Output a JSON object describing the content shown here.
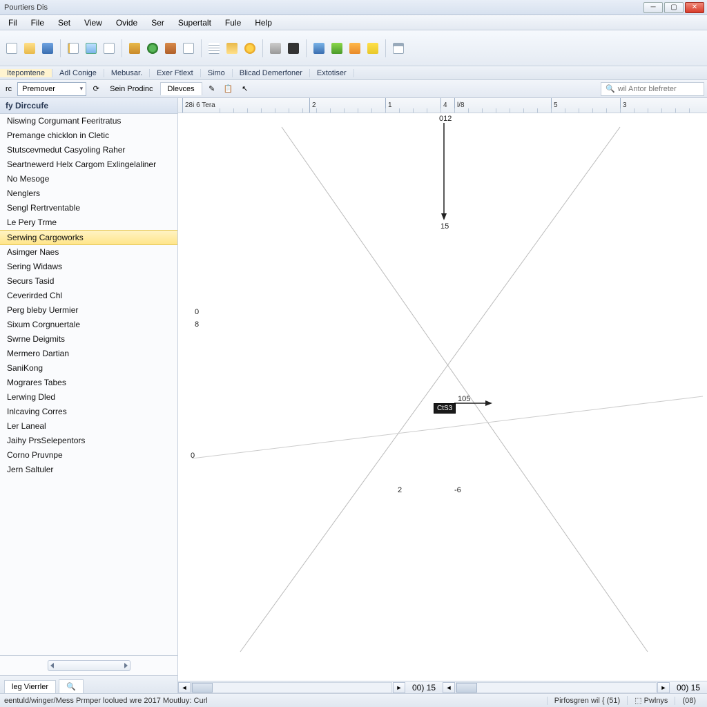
{
  "titlebar": {
    "title": "Pourtiers Dis"
  },
  "menu": [
    "Fil",
    "File",
    "Set",
    "View",
    "Ovide",
    "Ser",
    "Supertalt",
    "Fule",
    "Help"
  ],
  "ribbon_labels": [
    "Itepomtene",
    "Adl Conige",
    "Mebusar.",
    "Exer Ftlext",
    "Simo",
    "Blicad Demerfoner",
    "Extotiser"
  ],
  "toolbar2": {
    "left_label": "rc",
    "dropdown_value": "Premover",
    "sein_button": "Sein Prodinc",
    "tab_devices": "Dlevces",
    "search_placeholder": "wil Antor blefreter"
  },
  "sidebar": {
    "header": "fy Dirccufe",
    "items": [
      "Niswing Corgumant Feeritratus",
      "Premange chicklon in Cletic",
      "Stutscevmedut Casyoling Raher",
      "Seartnewerd Helx Cargom Exlingelaliner",
      "No Mesoge",
      "Nenglers",
      "Sengl Rertrventable",
      "Le Pery Trme",
      "Serwing Cargoworks",
      "Asimger Naes",
      "Sering Widaws",
      "Securs Tasid",
      "Ceverirded Chl",
      "Perg bleby Uermier",
      "Sixum Corgnuertale",
      "Swrne Deigmits",
      "Mermero Dartian",
      "SaniKong",
      "Mograres Tabes",
      "Lerwing Dled",
      "Inlcaving Corres",
      "Ler Laneal",
      "Jaihy PrsSelepentors",
      "Corno Pruvnpe",
      "Jern Saltuler"
    ],
    "selected_index": 8,
    "bottom_tab": "leg Vierrler"
  },
  "ruler": {
    "left_label": "28i 6 Tera",
    "ticks": [
      {
        "pos": 190,
        "label": "2"
      },
      {
        "pos": 300,
        "label": "1"
      },
      {
        "pos": 380,
        "label": "4"
      },
      {
        "pos": 400,
        "label": "l/8"
      },
      {
        "pos": 540,
        "label": "5"
      },
      {
        "pos": 640,
        "label": "3"
      }
    ]
  },
  "canvas": {
    "top_label": "012",
    "mid_top_label": "15",
    "left_mid_label_1": "0",
    "left_mid_label_2": "8",
    "left_low_label": "0",
    "bottom_pair_left": "2",
    "bottom_pair_right": "-6",
    "badge_text": "CtS3",
    "arrow_right_label": "105"
  },
  "hscroll_pages": {
    "left": "00) 15",
    "right": "00) 15"
  },
  "status": {
    "line1_left": "",
    "line2_left": "eentuld/winger/Mess Prmper loolued wre 2017 Moutluy: Curl",
    "line2_mid": "Pirfosgren wil { (51)",
    "line2_right1": "Pwlnys",
    "line2_right2": "(08)"
  },
  "colors": {
    "accent_yellow": "#ffe58a",
    "ribbon_bg": "#e5ebf3"
  }
}
